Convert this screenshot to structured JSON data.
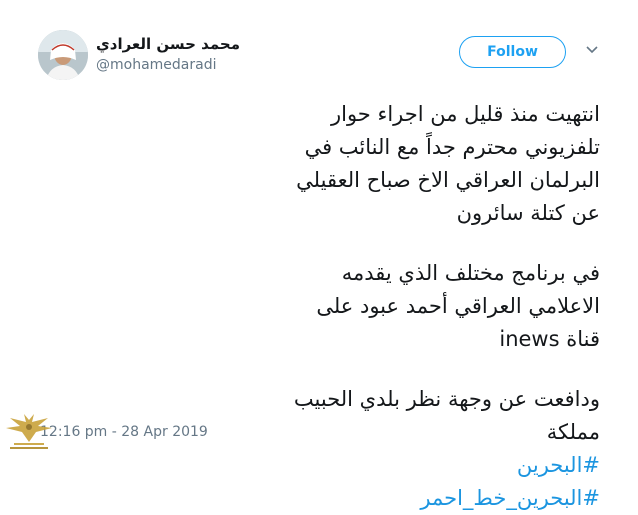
{
  "author": {
    "name": "محمد حسن العرادي",
    "handle": "@mohamedaradi"
  },
  "follow_label": "Follow",
  "tweet": {
    "paragraphs": [
      "انتهيت منذ قليل من اجراء حوار تلفزيوني محترم جداً مع النائب في البرلمان العراقي الاخ صباح العقيلي عن كتلة سائرون",
      "في برنامج مختلف الذي يقدمه الاعلامي العراقي أحمد عبود على قناة inews",
      "ودافعت عن وجهة نظر بلدي الحبيب مملكة"
    ],
    "hashtags": [
      "#البحرين",
      "#البحرين_خط_احمر"
    ]
  },
  "timestamp": "12:16 pm - 28 Apr 2019",
  "icons": {
    "caret": "chevron-down-icon",
    "watermark": "eagle-logo-icon"
  },
  "colors": {
    "accent": "#1da1f2",
    "hashtag": "#1b95e0",
    "text": "#14171a",
    "muted": "#657786"
  }
}
